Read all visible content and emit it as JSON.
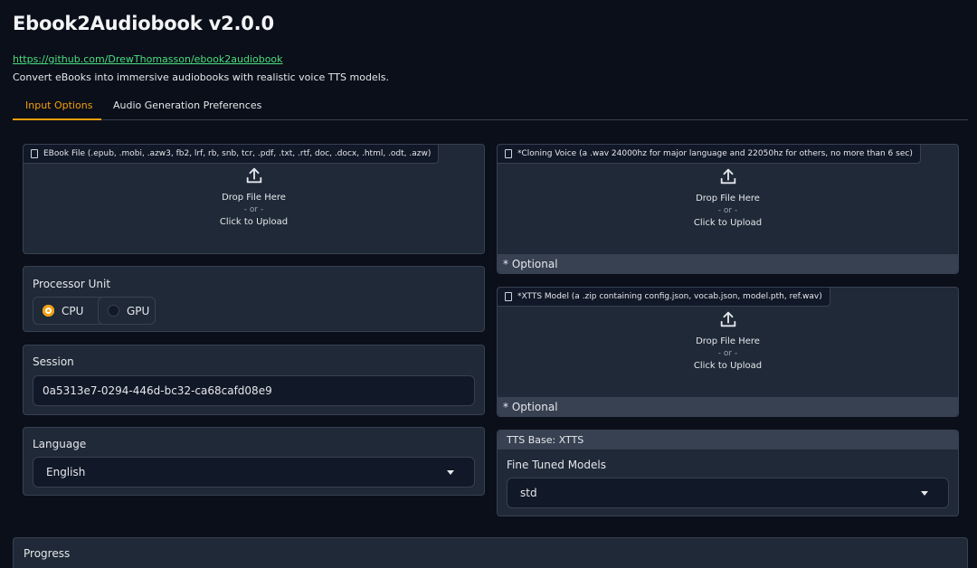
{
  "header": {
    "title": "Ebook2Audiobook v2.0.0",
    "link": "https://github.com/DrewThomasson/ebook2audiobook",
    "description": "Convert eBooks into immersive audiobooks with realistic voice TTS models."
  },
  "tabs": [
    {
      "label": "Input Options",
      "active": true
    },
    {
      "label": "Audio Generation Preferences",
      "active": false
    }
  ],
  "ebook_upload": {
    "label": "EBook File (.epub, .mobi, .azw3, fb2, lrf, rb, snb, tcr, .pdf, .txt, .rtf, doc, .docx, .html, .odt, .azw)",
    "drop_text": "Drop File Here",
    "or_text": "- or -",
    "click_text": "Click to Upload"
  },
  "processor": {
    "label": "Processor Unit",
    "options": [
      {
        "label": "CPU",
        "selected": true
      },
      {
        "label": "GPU",
        "selected": false
      }
    ]
  },
  "session": {
    "label": "Session",
    "value": "0a5313e7-0294-446d-bc32-ca68cafd08e9"
  },
  "language": {
    "label": "Language",
    "selected": "English"
  },
  "voice_upload": {
    "label": "*Cloning Voice (a .wav 24000hz for major language and 22050hz for others, no more than 6 sec)",
    "drop_text": "Drop File Here",
    "or_text": "- or -",
    "click_text": "Click to Upload",
    "note": "* Optional"
  },
  "xtts_upload": {
    "label": "*XTTS Model (a .zip containing config.json, vocab.json, model.pth, ref.wav)",
    "drop_text": "Drop File Here",
    "or_text": "- or -",
    "click_text": "Click to Upload",
    "note": "* Optional"
  },
  "tts": {
    "base_label": "TTS Base:  XTTS",
    "fine_tuned_label": "Fine Tuned Models",
    "selected": "std"
  },
  "progress": {
    "label": "Progress"
  },
  "colors": {
    "accent": "#f59e0b",
    "link": "#4ade80",
    "background": "#0b0f19",
    "panel": "#1f2937"
  }
}
